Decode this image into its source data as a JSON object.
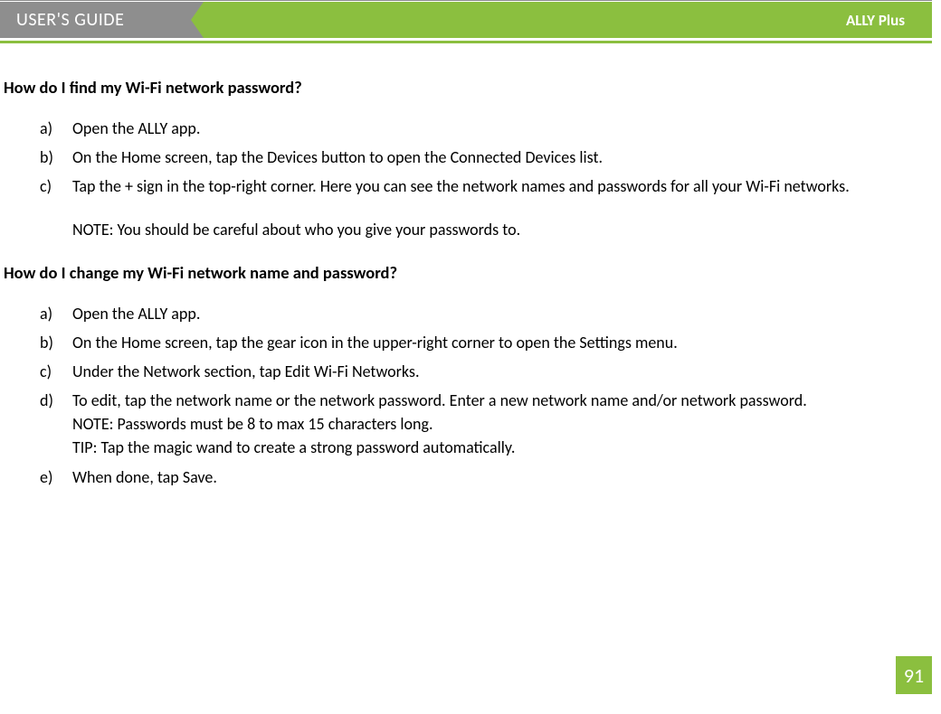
{
  "header": {
    "guide_label": "USER'S GUIDE",
    "product": "ALLY Plus"
  },
  "sections": [
    {
      "question": "How do I find my Wi-Fi network password?",
      "items": [
        {
          "marker": "a)",
          "text": "Open the ALLY app."
        },
        {
          "marker": "b)",
          "text": "On the Home screen, tap the Devices button to open the Connected Devices list."
        },
        {
          "marker": "c)",
          "text": "Tap the + sign in the top-right corner. Here you can see the network names and passwords for all your Wi-Fi networks."
        }
      ],
      "note": "NOTE: You should be careful about who you give your passwords to."
    },
    {
      "question": "How do I change my Wi-Fi network name and password?",
      "items": [
        {
          "marker": "a)",
          "text": "Open the ALLY app."
        },
        {
          "marker": "b)",
          "text": "On the Home screen, tap the gear icon in the upper-right corner to open the Settings menu."
        },
        {
          "marker": "c)",
          "text": "Under the Network section, tap Edit Wi-Fi Networks."
        },
        {
          "marker": "d)",
          "text": "To edit, tap the network name or the network password. Enter a new network name and/or network password.",
          "extras": [
            "NOTE: Passwords must be 8 to max 15 characters long.",
            "TIP: Tap the magic wand to create a strong password automatically."
          ]
        },
        {
          "marker": "e)",
          "text": "When done, tap Save."
        }
      ]
    }
  ],
  "page_number": "91"
}
